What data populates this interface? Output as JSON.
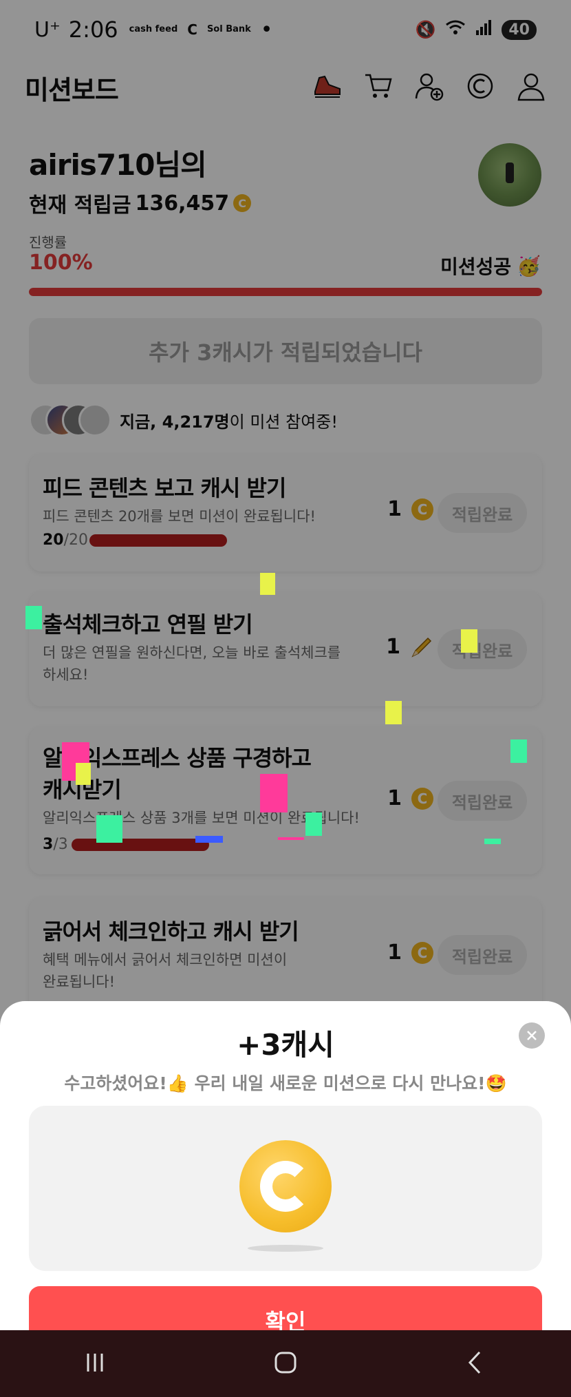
{
  "status_bar": {
    "carrier": "U⁺",
    "time": "2:06",
    "mini_apps": [
      "cash feed",
      "C",
      "Sol Bank"
    ],
    "dot": "•",
    "battery": "40"
  },
  "header": {
    "title": "미션보드",
    "icons": [
      "sneaker-icon",
      "cart-icon",
      "add-friend-icon",
      "cash-icon",
      "profile-icon"
    ]
  },
  "user": {
    "name": "airis710님의",
    "balance_label": "현재 적립금",
    "balance_value": "136,457",
    "coin_glyph": "C"
  },
  "progress": {
    "label": "진행률",
    "percent_text": "100%",
    "fraction": 1.0,
    "success_label": "미션성공",
    "success_emoji": "🥳"
  },
  "notice": "추가 3캐시가 적립되었습니다",
  "participants": {
    "prefix": "지금,",
    "count": "4,217명",
    "suffix": "이 미션 참여중!"
  },
  "missions": [
    {
      "title": "피드 콘텐츠 보고 캐시 받기",
      "desc": "피드 콘텐츠 20개를 보면 미션이 완료됩니다!",
      "count_done": "20",
      "count_total": "/20",
      "reward": "1",
      "reward_icon": "coin-icon",
      "button": "적립완료"
    },
    {
      "title": "출석체크하고 연필 받기",
      "desc_line1": "더 많은 연필을 원하신다면, 오늘 바로 출석체크를",
      "desc_line2": "하세요!",
      "reward": "1",
      "reward_icon": "pencil-icon",
      "button": "적립완료"
    },
    {
      "title_line1": "알리익스프레스 상품 구경하고",
      "title_line2": "캐시받기",
      "desc": "알리익스프레스 상품 3개를 보면 미션이 완료됩니다!",
      "count_done": "3",
      "count_total": "/3",
      "reward": "1",
      "reward_icon": "coin-icon",
      "button": "적립완료"
    },
    {
      "title": "긁어서 체크인하고 캐시 받기",
      "desc_line1": "혜택 메뉴에서 긁어서 체크인하면 미션이",
      "desc_line2": "완료됩니다!",
      "reward": "1",
      "reward_icon": "coin-icon",
      "button": "적립완료"
    }
  ],
  "sheet": {
    "title": "+3캐시",
    "subtitle": "수고하셨어요!👍 우리 내일 새로운 미션으로 다시 만나요!🤩",
    "confirm": "확인"
  },
  "colors": {
    "accent": "#e53b3b",
    "confirm": "#ff5050",
    "coin": "#f2b61f"
  }
}
